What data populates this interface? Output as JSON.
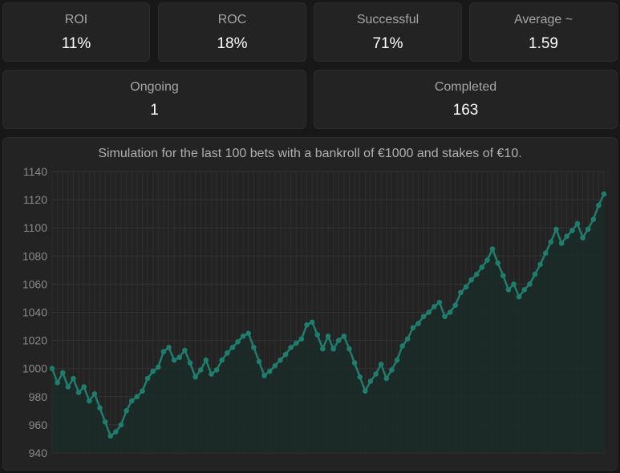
{
  "stats_row1": [
    {
      "label": "ROI",
      "value": "11%"
    },
    {
      "label": "ROC",
      "value": "18%"
    },
    {
      "label": "Successful",
      "value": "71%"
    },
    {
      "label": "Average ~",
      "value": "1.59"
    }
  ],
  "stats_row2": [
    {
      "label": "Ongoing",
      "value": "1"
    },
    {
      "label": "Completed",
      "value": "163"
    }
  ],
  "colors": {
    "line": "#1e7d6c",
    "area": "#1a2c28",
    "grid": "#2e2e2e",
    "card_bg": "#232323",
    "page_bg": "#181818"
  },
  "chart_data": {
    "type": "area",
    "title": "Simulation for the last 100 bets with a bankroll of €1000 and stakes of €10.",
    "xlabel": "",
    "ylabel": "",
    "ylim": [
      940,
      1140
    ],
    "yticks": [
      940,
      960,
      980,
      1000,
      1020,
      1040,
      1060,
      1080,
      1100,
      1120,
      1140
    ],
    "grid": true,
    "series": [
      {
        "values": [
          1000,
          990,
          997,
          987,
          993,
          983,
          987,
          977,
          982,
          972,
          962,
          952,
          955,
          960,
          970,
          977,
          980,
          984,
          993,
          998,
          1001,
          1012,
          1015,
          1006,
          1008,
          1013,
          1004,
          994,
          999,
          1006,
          996,
          999,
          1006,
          1011,
          1015,
          1019,
          1023,
          1025,
          1015,
          1005,
          995,
          998,
          1002,
          1006,
          1010,
          1015,
          1018,
          1021,
          1031,
          1033,
          1024,
          1014,
          1023,
          1014,
          1020,
          1023,
          1014,
          1004,
          994,
          984,
          991,
          996,
          1003,
          993,
          999,
          1006,
          1016,
          1021,
          1029,
          1032,
          1037,
          1040,
          1044,
          1047,
          1037,
          1040,
          1045,
          1054,
          1058,
          1063,
          1067,
          1072,
          1077,
          1085,
          1075,
          1066,
          1056,
          1060,
          1051,
          1056,
          1060,
          1067,
          1074,
          1082,
          1090,
          1099,
          1089,
          1094,
          1098,
          1103,
          1093,
          1099,
          1106,
          1116,
          1124
        ]
      }
    ]
  }
}
